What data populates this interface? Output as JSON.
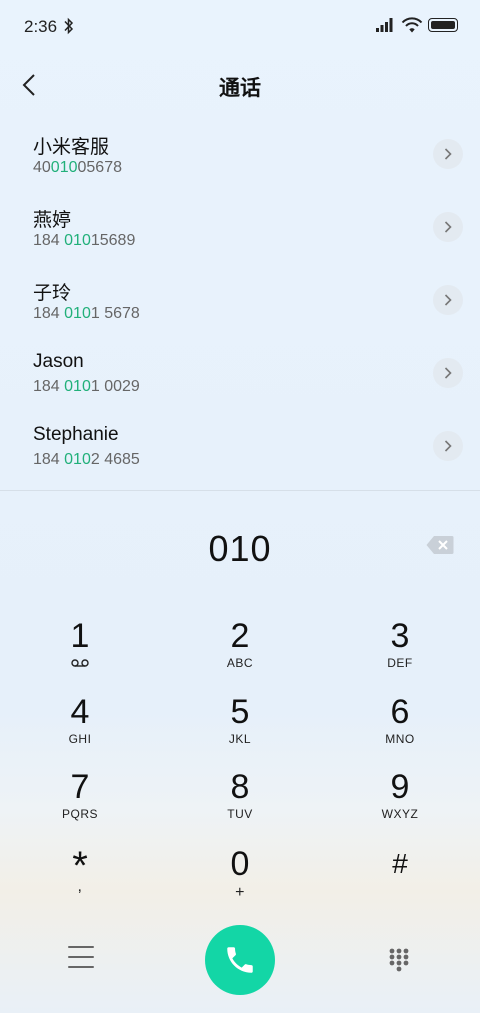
{
  "status_bar": {
    "time": "2:36"
  },
  "header": {
    "title": "通话"
  },
  "contacts": [
    {
      "name": "小米客服",
      "number_pre": "40",
      "number_match": "010",
      "number_post": "05678"
    },
    {
      "name": "燕婷",
      "number_pre": "184 ",
      "number_match": "010",
      "number_post": "15689"
    },
    {
      "name": "子玲",
      "number_pre": "184 ",
      "number_match": "010",
      "number_post": "1 5678"
    },
    {
      "name": "Jason",
      "number_pre": "184 ",
      "number_match": "010",
      "number_post": "1 0029"
    },
    {
      "name": "Stephanie",
      "number_pre": "184 ",
      "number_match": "010",
      "number_post": "2 4685"
    }
  ],
  "dialer": {
    "input": "010",
    "keys": [
      {
        "digit": "1",
        "letters": ""
      },
      {
        "digit": "2",
        "letters": "ABC"
      },
      {
        "digit": "3",
        "letters": "DEF"
      },
      {
        "digit": "4",
        "letters": "GHI"
      },
      {
        "digit": "5",
        "letters": "JKL"
      },
      {
        "digit": "6",
        "letters": "MNO"
      },
      {
        "digit": "7",
        "letters": "PQRS"
      },
      {
        "digit": "8",
        "letters": "TUV"
      },
      {
        "digit": "9",
        "letters": "WXYZ"
      },
      {
        "digit": "*",
        "letters": ","
      },
      {
        "digit": "0",
        "letters": "+"
      },
      {
        "digit": "#",
        "letters": ""
      }
    ]
  },
  "colors": {
    "match": "#21b07a",
    "call_button": "#13d6a6"
  },
  "icons": {
    "back": "chevron-left-icon",
    "chevron": "chevron-right-icon",
    "backspace": "backspace-icon",
    "call": "phone-icon",
    "menu": "menu-icon",
    "dialpad": "dialpad-icon",
    "voicemail": "voicemail-icon"
  }
}
